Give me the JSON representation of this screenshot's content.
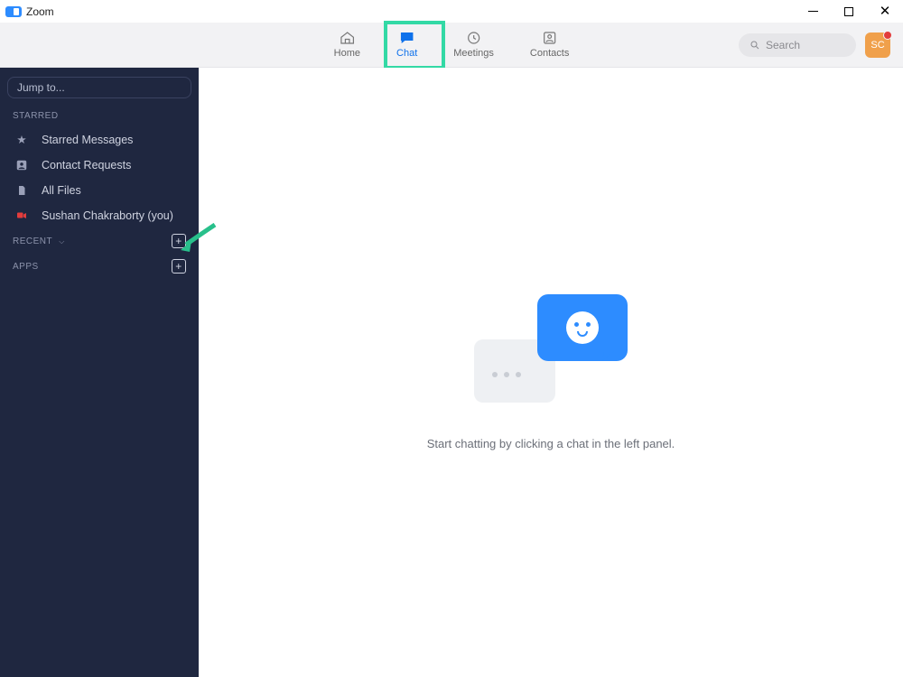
{
  "window": {
    "title": "Zoom"
  },
  "nav": {
    "home": "Home",
    "chat": "Chat",
    "meetings": "Meetings",
    "contacts": "Contacts"
  },
  "search": {
    "placeholder": "Search"
  },
  "avatar": {
    "initials": "SC"
  },
  "sidebar": {
    "jump_placeholder": "Jump to...",
    "sections": {
      "starred": "STARRED",
      "recent": "RECENT",
      "apps": "APPS"
    },
    "items": {
      "starred_messages": "Starred Messages",
      "contact_requests": "Contact Requests",
      "all_files": "All Files",
      "self": "Sushan Chakraborty (you)"
    }
  },
  "empty": {
    "message": "Start chatting by clicking a chat in the left panel."
  }
}
